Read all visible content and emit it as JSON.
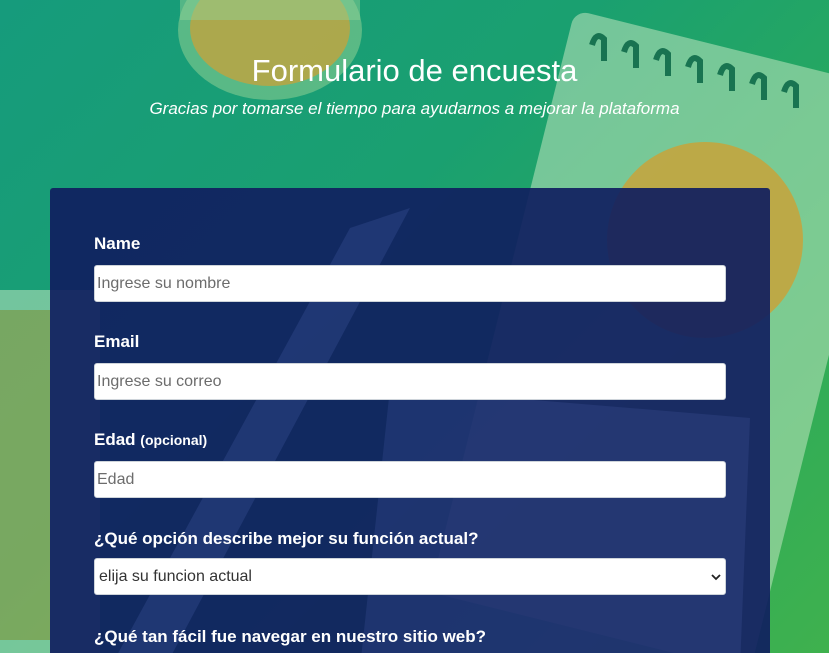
{
  "header": {
    "title": "Formulario de encuesta",
    "subtitle": "Gracias por tomarse el tiempo para ayudarnos a mejorar la plataforma"
  },
  "form": {
    "name": {
      "label": "Name",
      "placeholder": "Ingrese su nombre",
      "value": ""
    },
    "email": {
      "label": "Email",
      "placeholder": "Ingrese su correo",
      "value": ""
    },
    "age": {
      "label": "Edad",
      "optional_note": "(opcional)",
      "placeholder": "Edad",
      "value": ""
    },
    "role": {
      "label": "¿Qué opción describe mejor su función actual?",
      "selected": "elija su funcion actual",
      "icon": "chevron-down-icon"
    },
    "navigation": {
      "label": "¿Qué tan fácil fue navegar en nuestro sitio web?"
    }
  },
  "colors": {
    "background_top": "#169b7c",
    "background_bottom": "#3fb14e",
    "card": "#101e60",
    "text": "#ffffff"
  }
}
